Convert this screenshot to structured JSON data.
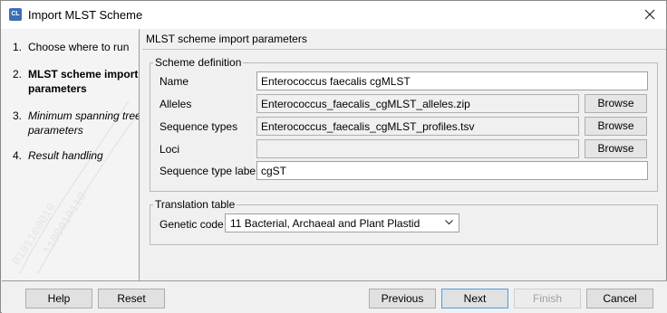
{
  "window": {
    "title": "Import MLST Scheme",
    "app_icon_text": "CL"
  },
  "steps": [
    {
      "num": "1.",
      "label": "Choose where to run",
      "state": "done"
    },
    {
      "num": "2.",
      "label": "MLST scheme import parameters",
      "state": "current"
    },
    {
      "num": "3.",
      "label": "Minimum spanning tree parameters",
      "state": "future"
    },
    {
      "num": "4.",
      "label": "Result handling",
      "state": "future"
    }
  ],
  "panel": {
    "title": "MLST scheme import parameters"
  },
  "scheme_definition": {
    "legend": "Scheme definition",
    "name": {
      "label": "Name",
      "value": "Enterococcus faecalis cgMLST"
    },
    "alleles": {
      "label": "Alleles",
      "value": "Enterococcus_faecalis_cgMLST_alleles.zip",
      "button": "Browse"
    },
    "sequence_types": {
      "label": "Sequence types",
      "value": "Enterococcus_faecalis_cgMLST_profiles.tsv",
      "button": "Browse"
    },
    "loci": {
      "label": "Loci",
      "value": "",
      "button": "Browse"
    },
    "sequence_type_label": {
      "label": "Sequence type label",
      "value": "cgST"
    }
  },
  "translation_table": {
    "legend": "Translation table",
    "genetic_code": {
      "label": "Genetic code",
      "value": "11 Bacterial, Archaeal and Plant Plastid"
    }
  },
  "footer": {
    "help": "Help",
    "reset": "Reset",
    "previous": "Previous",
    "next": "Next",
    "finish": "Finish",
    "cancel": "Cancel"
  }
}
